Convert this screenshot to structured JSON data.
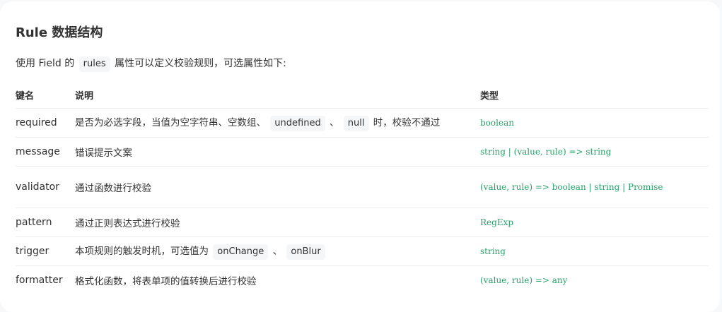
{
  "heading": "Rule 数据结构",
  "intro": {
    "before": "使用 Field 的",
    "code": "rules",
    "after": "属性可以定义校验规则，可选属性如下:"
  },
  "table": {
    "headers": {
      "name": "键名",
      "desc": "说明",
      "type": "类型"
    },
    "rows": [
      {
        "name": "required",
        "desc_parts": [
          "是否为必选字段，当值为空字符串、空数组、",
          "undefined",
          "、",
          "null",
          "时，校验不通过"
        ],
        "type": "boolean"
      },
      {
        "name": "message",
        "desc": "错误提示文案",
        "type": "string | (value, rule) => string"
      },
      {
        "name": "validator",
        "desc": "通过函数进行校验",
        "type": "(value, rule) => boolean | string | Promise"
      },
      {
        "name": "pattern",
        "desc": "通过正则表达式进行校验",
        "type": "RegExp"
      },
      {
        "name": "trigger",
        "desc_parts": [
          "本项规则的触发时机，可选值为",
          "onChange",
          "、",
          "onBlur"
        ],
        "type": "string"
      },
      {
        "name": "formatter",
        "desc": "格式化函数，将表单项的值转换后进行校验",
        "type": "(value, rule) => any"
      }
    ]
  }
}
